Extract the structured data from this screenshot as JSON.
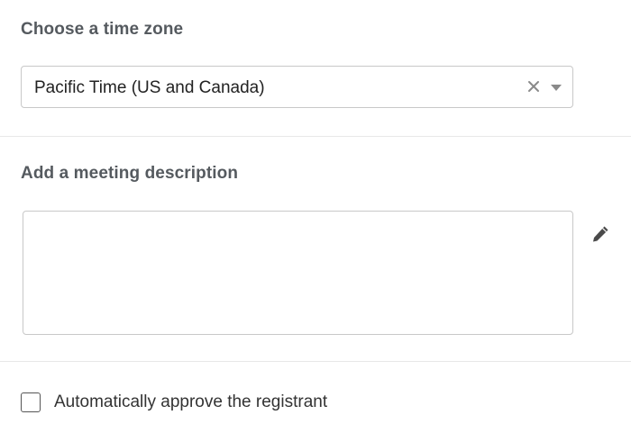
{
  "timezone": {
    "label": "Choose a time zone",
    "selected_value": "Pacific Time (US and Canada)",
    "clear_icon": "close-icon",
    "dropdown_icon": "caret-down-icon"
  },
  "description": {
    "label": "Add a meeting description",
    "value": "",
    "edit_icon": "pencil-icon"
  },
  "approval": {
    "label": "Automatically approve the registrant",
    "checked": false
  },
  "colors": {
    "label_text": "#555a5f",
    "border": "#c8c8c8",
    "divider": "#e8e8e8",
    "icon": "#8a8a8a",
    "pencil": "#4a4a4a"
  }
}
